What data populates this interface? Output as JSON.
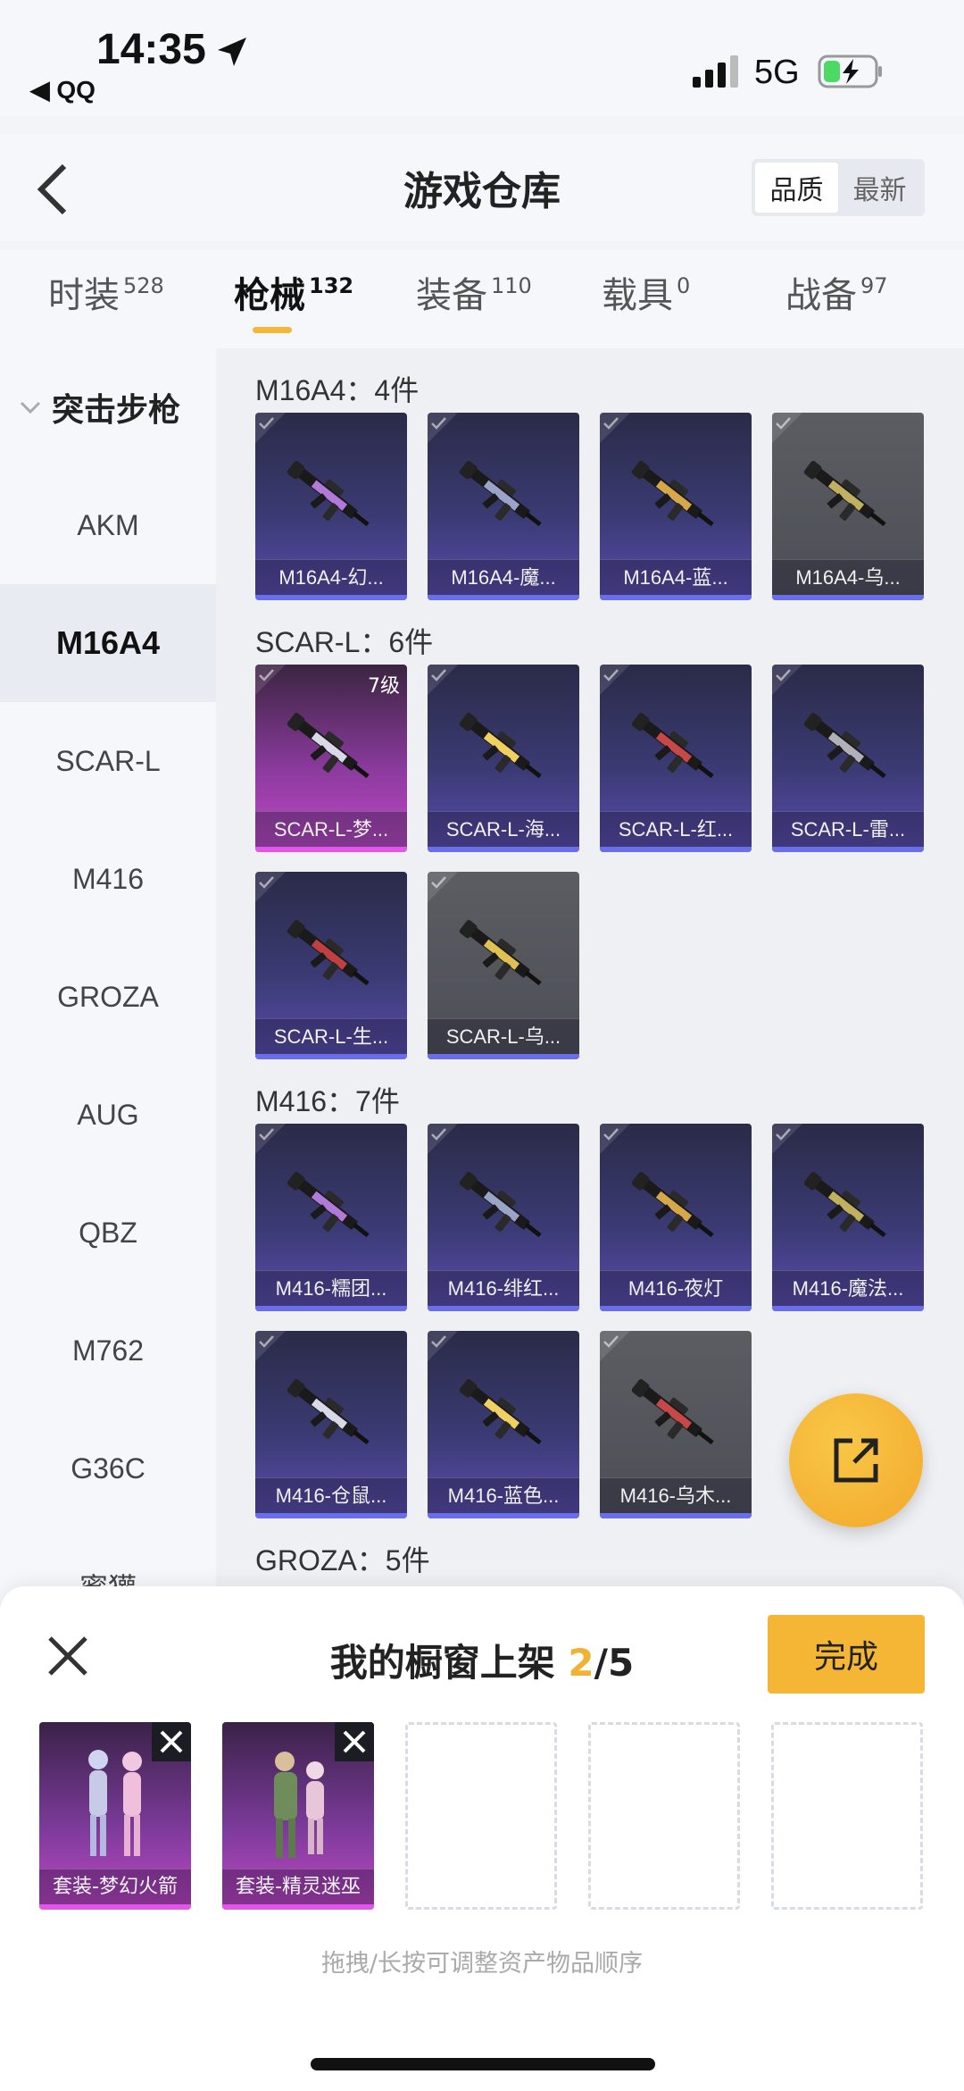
{
  "status": {
    "time": "14:35",
    "back_app": "◀ QQ",
    "network": "5G"
  },
  "nav": {
    "title": "游戏仓库",
    "sort": [
      "品质",
      "最新"
    ]
  },
  "tabs": [
    {
      "label": "时装",
      "count": "528"
    },
    {
      "label": "枪械",
      "count": "132"
    },
    {
      "label": "装备",
      "count": "110"
    },
    {
      "label": "载具",
      "count": "0"
    },
    {
      "label": "战备",
      "count": "97"
    }
  ],
  "sidebar": {
    "category": "突击步枪",
    "items": [
      "AKM",
      "M16A4",
      "SCAR-L",
      "M416",
      "GROZA",
      "AUG",
      "QBZ",
      "M762",
      "G36C",
      "蜜獾"
    ]
  },
  "groups": [
    {
      "title": "M16A4：4件",
      "items": [
        {
          "label": "M16A4-幻...",
          "style": "blue"
        },
        {
          "label": "M16A4-魔...",
          "style": "blue"
        },
        {
          "label": "M16A4-蓝...",
          "style": "blue"
        },
        {
          "label": "M16A4-乌...",
          "style": "gray"
        }
      ]
    },
    {
      "title": "SCAR-L：6件",
      "items": [
        {
          "label": "SCAR-L-梦...",
          "style": "pink",
          "level": "7级"
        },
        {
          "label": "SCAR-L-海...",
          "style": "blue"
        },
        {
          "label": "SCAR-L-红...",
          "style": "blue"
        },
        {
          "label": "SCAR-L-雷...",
          "style": "blue"
        },
        {
          "label": "SCAR-L-生...",
          "style": "blue"
        },
        {
          "label": "SCAR-L-乌...",
          "style": "gray"
        }
      ]
    },
    {
      "title": "M416：7件",
      "items": [
        {
          "label": "M416-糯团...",
          "style": "blue"
        },
        {
          "label": "M416-绯红...",
          "style": "blue"
        },
        {
          "label": "M416-夜灯",
          "style": "blue"
        },
        {
          "label": "M416-魔法...",
          "style": "blue"
        },
        {
          "label": "M416-仓鼠...",
          "style": "blue"
        },
        {
          "label": "M416-蓝色...",
          "style": "blue"
        },
        {
          "label": "M416-乌木...",
          "style": "gray"
        }
      ]
    },
    {
      "title": "GROZA：5件",
      "items": []
    }
  ],
  "panel": {
    "title_prefix": "我的橱窗上架 ",
    "count_current": "2",
    "count_total": "/5",
    "done_label": "完成",
    "slots": [
      {
        "label": "套装-梦幻火箭"
      },
      {
        "label": "套装-精灵迷巫"
      }
    ],
    "hint": "拖拽/长按可调整资产物品顺序"
  },
  "colors": {
    "accent": "#f5b636",
    "card_blue": "#3b3a73",
    "card_pink": "#c34ac9",
    "card_gray": "#55575d"
  }
}
